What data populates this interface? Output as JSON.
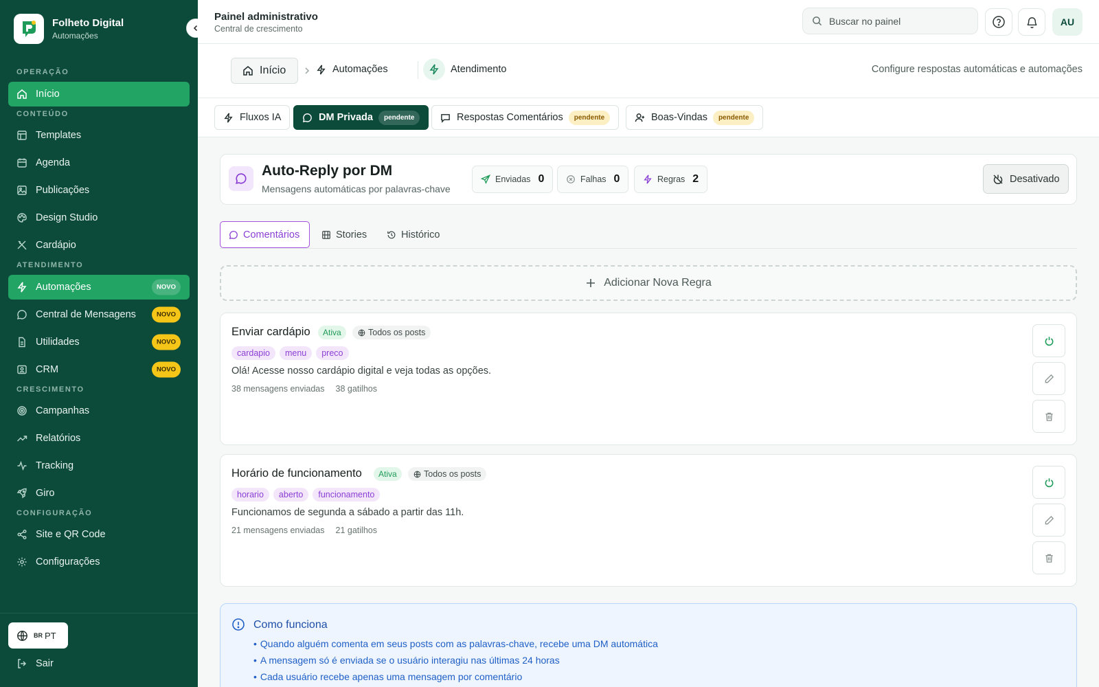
{
  "brand": {
    "title": "Folheto Digital",
    "subtitle": "Automações"
  },
  "sidebar": {
    "sections": {
      "operacao": "OPERAÇÃO",
      "conteudo": "CONTEÚDO",
      "atendimento": "ATENDIMENTO",
      "crescimento": "CRESCIMENTO",
      "configuracao": "CONFIGURAÇÃO"
    },
    "items": {
      "inicio": "Início",
      "templates": "Templates",
      "agenda": "Agenda",
      "publicacoes": "Publicações",
      "design_studio": "Design Studio",
      "cardapio": "Cardápio",
      "automacoes": "Automações",
      "central_mensagens": "Central de Mensagens",
      "utilidades": "Utilidades",
      "crm": "CRM",
      "campanhas": "Campanhas",
      "relatorios": "Relatórios",
      "tracking": "Tracking",
      "giro": "Giro",
      "site_qr": "Site e QR Code",
      "configuracoes": "Configurações"
    },
    "badge_novo": "NOVO",
    "lang": {
      "flag": "BR",
      "code": "PT"
    },
    "logout": "Sair"
  },
  "header": {
    "title": "Painel administrativo",
    "subtitle": "Central de crescimento",
    "search_placeholder": "Buscar no painel",
    "avatar": "AU"
  },
  "breadcrumb": {
    "home": "Início",
    "automacoes": "Automações",
    "atendimento": "Atendimento",
    "description": "Configure respostas automáticas e automações"
  },
  "tabs": {
    "fluxos": "Fluxos IA",
    "dm": "DM Privada",
    "respostas": "Respostas Comentários",
    "boas_vindas": "Boas-Vindas",
    "pendente": "pendente"
  },
  "panel": {
    "title": "Auto-Reply por DM",
    "subtitle": "Mensagens automáticas por palavras-chave",
    "stats": {
      "enviadas_label": "Enviadas",
      "enviadas": "0",
      "falhas_label": "Falhas",
      "falhas": "0",
      "regras_label": "Regras",
      "regras": "2"
    },
    "status": "Desativado"
  },
  "inner_tabs": {
    "comentarios": "Comentários",
    "stories": "Stories",
    "historico": "Histórico"
  },
  "add_rule": "Adicionar Nova Regra",
  "rules": [
    {
      "name": "Enviar cardápio",
      "status": "Ativa",
      "scope": "Todos os posts",
      "keywords": [
        "cardapio",
        "menu",
        "preco"
      ],
      "message": "Olá! Acesse nosso cardápio digital e veja todas as opções.",
      "sent": "38 mensagens enviadas",
      "triggers": "38 gatilhos"
    },
    {
      "name": "Horário de funcionamento",
      "status": "Ativa",
      "scope": "Todos os posts",
      "keywords": [
        "horario",
        "aberto",
        "funcionamento"
      ],
      "message": "Funcionamos de segunda a sábado a partir das 11h.",
      "sent": "21 mensagens enviadas",
      "triggers": "21 gatilhos"
    }
  ],
  "info": {
    "title": "Como funciona",
    "items": [
      "Quando alguém comenta em seus posts com as palavras-chave, recebe uma DM automática",
      "A mensagem só é enviada se o usuário interagiu nas últimas 24 horas",
      "Cada usuário recebe apenas uma mensagem por comentário"
    ]
  },
  "colors": {
    "sidebar": "#0c4a3a",
    "active_green": "#22a465",
    "purple": "#8b3fd4",
    "badge_yellow": "#f5c518",
    "info_blue": "#1f5fc6"
  }
}
